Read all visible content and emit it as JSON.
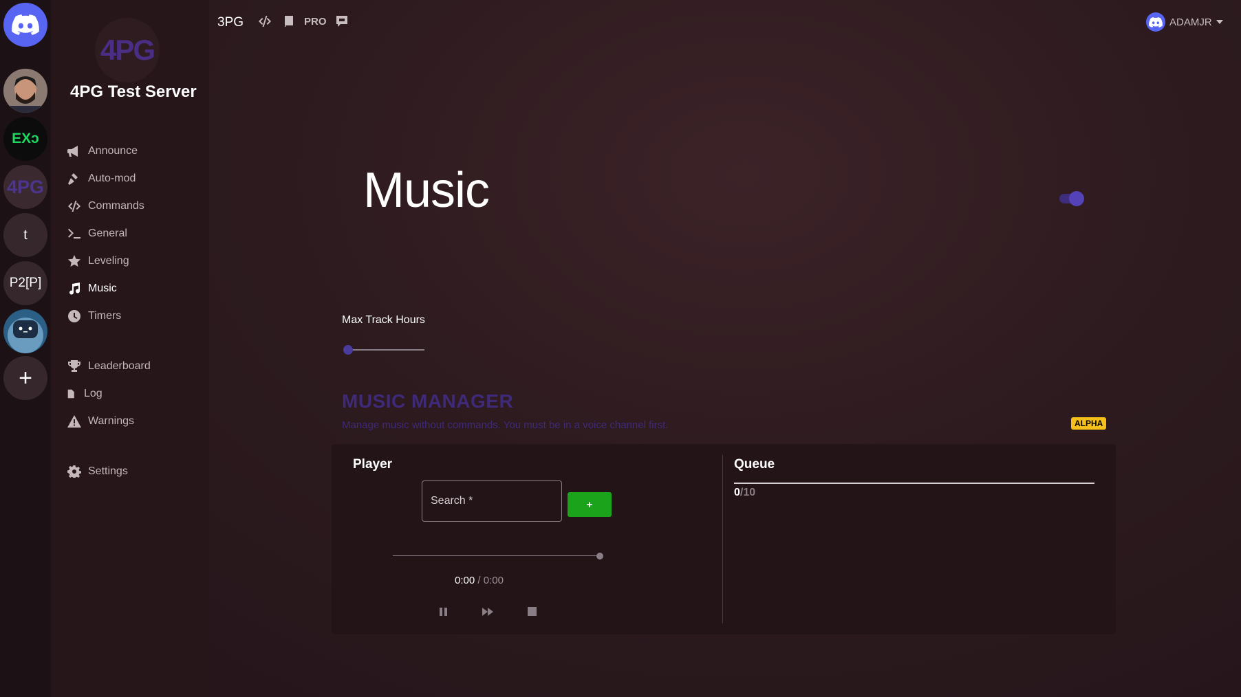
{
  "rail": {
    "servers": [
      {
        "name": "discord-home",
        "label": ""
      },
      {
        "name": "server-avatar-person",
        "label": ""
      },
      {
        "name": "server-exo",
        "label": "EXɔ"
      },
      {
        "name": "server-4pg",
        "label": "4PG"
      },
      {
        "name": "server-t",
        "label": "t"
      },
      {
        "name": "server-p2p",
        "label": "P2[P]"
      },
      {
        "name": "server-bot",
        "label": ""
      }
    ],
    "add_label": "+"
  },
  "sidebar": {
    "logo_text": "4PG",
    "server_name": "4PG Test Server",
    "modules": [
      {
        "label": "Announce",
        "icon": "megaphone-icon"
      },
      {
        "label": "Auto-mod",
        "icon": "gavel-icon"
      },
      {
        "label": "Commands",
        "icon": "code-icon"
      },
      {
        "label": "General",
        "icon": "terminal-icon"
      },
      {
        "label": "Leveling",
        "icon": "star-icon"
      },
      {
        "label": "Music",
        "icon": "music-note-icon",
        "active": true
      },
      {
        "label": "Timers",
        "icon": "clock-icon"
      }
    ],
    "tools": [
      {
        "label": "Leaderboard",
        "icon": "trophy-icon"
      },
      {
        "label": "Log",
        "icon": "document-icon"
      },
      {
        "label": "Warnings",
        "icon": "warning-icon"
      }
    ],
    "settings": {
      "label": "Settings",
      "icon": "gear-icon"
    }
  },
  "topbar": {
    "brand": "3PG",
    "pro_label": "PRO",
    "icons": [
      "code-icon",
      "book-icon",
      "chat-icon"
    ],
    "username": "ADAMJR"
  },
  "main": {
    "title": "Music",
    "enabled": true,
    "max_track_hours_label": "Max Track Hours",
    "max_track_hours_value": 0,
    "manager_title": "MUSIC MANAGER",
    "manager_subtitle": "Manage music without commands. You must be in a voice channel first.",
    "badge": "ALPHA",
    "player": {
      "heading": "Player",
      "search_placeholder": "Search *",
      "add_label": "+",
      "position": 1.0,
      "current_time": "0:00",
      "separator": " / ",
      "total_time": "0:00",
      "controls": [
        "pause-icon",
        "skip-icon",
        "stop-icon"
      ]
    },
    "queue": {
      "heading": "Queue",
      "count": "0",
      "max": "/10"
    }
  },
  "colors": {
    "accent": "#5443b8",
    "manager_heading": "#3f2a7a",
    "add_button": "#1ba31b",
    "badge": "#f6c01a"
  }
}
